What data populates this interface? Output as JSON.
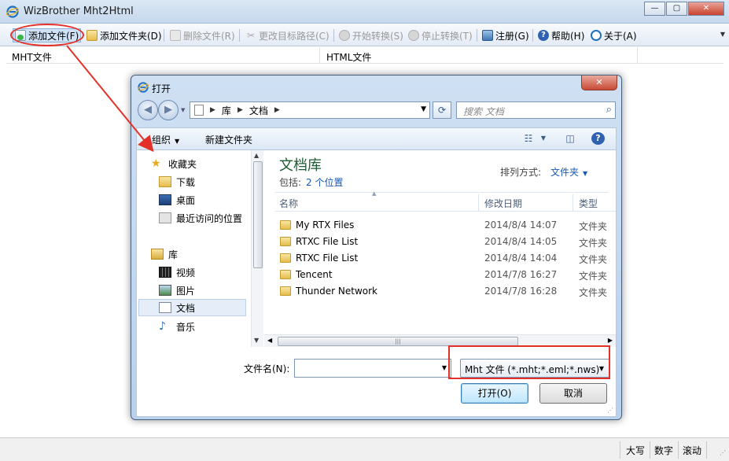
{
  "window": {
    "title": "WizBrother Mht2Html",
    "min": "—",
    "max": "▢",
    "close": "✕"
  },
  "toolbar": {
    "add_file": "添加文件(F)",
    "add_folder": "添加文件夹(D)",
    "delete_file": "删除文件(R)",
    "change_path": "更改目标路径(C)",
    "start": "开始转换(S)",
    "stop": "停止转换(T)",
    "register": "注册(G)",
    "help": "帮助(H)",
    "about": "关于(A)"
  },
  "columns": {
    "mht": "MHT文件",
    "html": "HTML文件"
  },
  "status": {
    "caps": "大写",
    "num": "数字",
    "scroll": "滚动"
  },
  "dialog": {
    "title": "打开",
    "close": "✕",
    "breadcrumb": [
      "库",
      "文档"
    ],
    "search_placeholder": "搜索 文档",
    "organize": "组织",
    "new_folder": "新建文件夹",
    "help_icon": "?",
    "nav": {
      "favorites": "收藏夹",
      "downloads": "下载",
      "desktop": "桌面",
      "recent": "最近访问的位置",
      "libraries": "库",
      "videos": "视频",
      "pictures": "图片",
      "documents": "文档",
      "music": "音乐"
    },
    "library_title": "文档库",
    "library_includes": "包括:",
    "library_locations": "2 个位置",
    "arrange_label": "排列方式:",
    "arrange_value": "文件夹",
    "list_headers": {
      "name": "名称",
      "date": "修改日期",
      "type": "类型"
    },
    "files": [
      {
        "name": "My RTX Files",
        "date": "2014/8/4 14:07",
        "type": "文件夹"
      },
      {
        "name": "RTXC File List",
        "date": "2014/8/4 14:05",
        "type": "文件夹"
      },
      {
        "name": "RTXC File List",
        "date": "2014/8/4 14:04",
        "type": "文件夹"
      },
      {
        "name": "Tencent",
        "date": "2014/7/8 16:27",
        "type": "文件夹"
      },
      {
        "name": "Thunder Network",
        "date": "2014/7/8 16:28",
        "type": "文件夹"
      }
    ],
    "filename_label": "文件名(N):",
    "filename_value": "",
    "filetype": "Mht 文件 (*.mht;*.eml;*.nws)",
    "open_button": "打开(O)",
    "cancel_button": "取消"
  },
  "colors": {
    "annotation": "#e3312a",
    "link": "#1a58b5",
    "library_title": "#1e5b33"
  }
}
